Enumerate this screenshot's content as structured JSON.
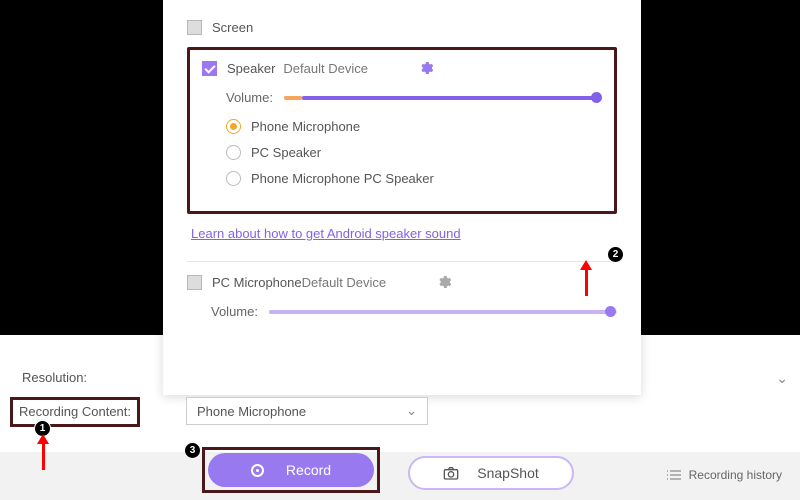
{
  "panel": {
    "screen_label": "Screen",
    "speaker": {
      "label": "Speaker",
      "device": "Default Device",
      "volume_label": "Volume:",
      "volume_percent": 98,
      "options": [
        "Phone Microphone",
        "PC Speaker",
        "Phone Microphone  PC Speaker"
      ],
      "selected_option": 0
    },
    "help_link": "Learn about how to get Android speaker sound",
    "pc_mic": {
      "label": "PC Microphone",
      "device": "Default Device",
      "volume_label": "Volume:",
      "volume_percent": 98
    }
  },
  "resolution_label": "Resolution:",
  "recording_content_label": "Recording Content:",
  "dropdown_value": "Phone Microphone",
  "record_button": "Record",
  "snapshot_button": "SnapShot",
  "history_label": "Recording history",
  "callouts": {
    "one": "1",
    "two": "2",
    "three": "3"
  },
  "colors": {
    "accent": "#9979ef",
    "accent_light": "#b79df5"
  }
}
